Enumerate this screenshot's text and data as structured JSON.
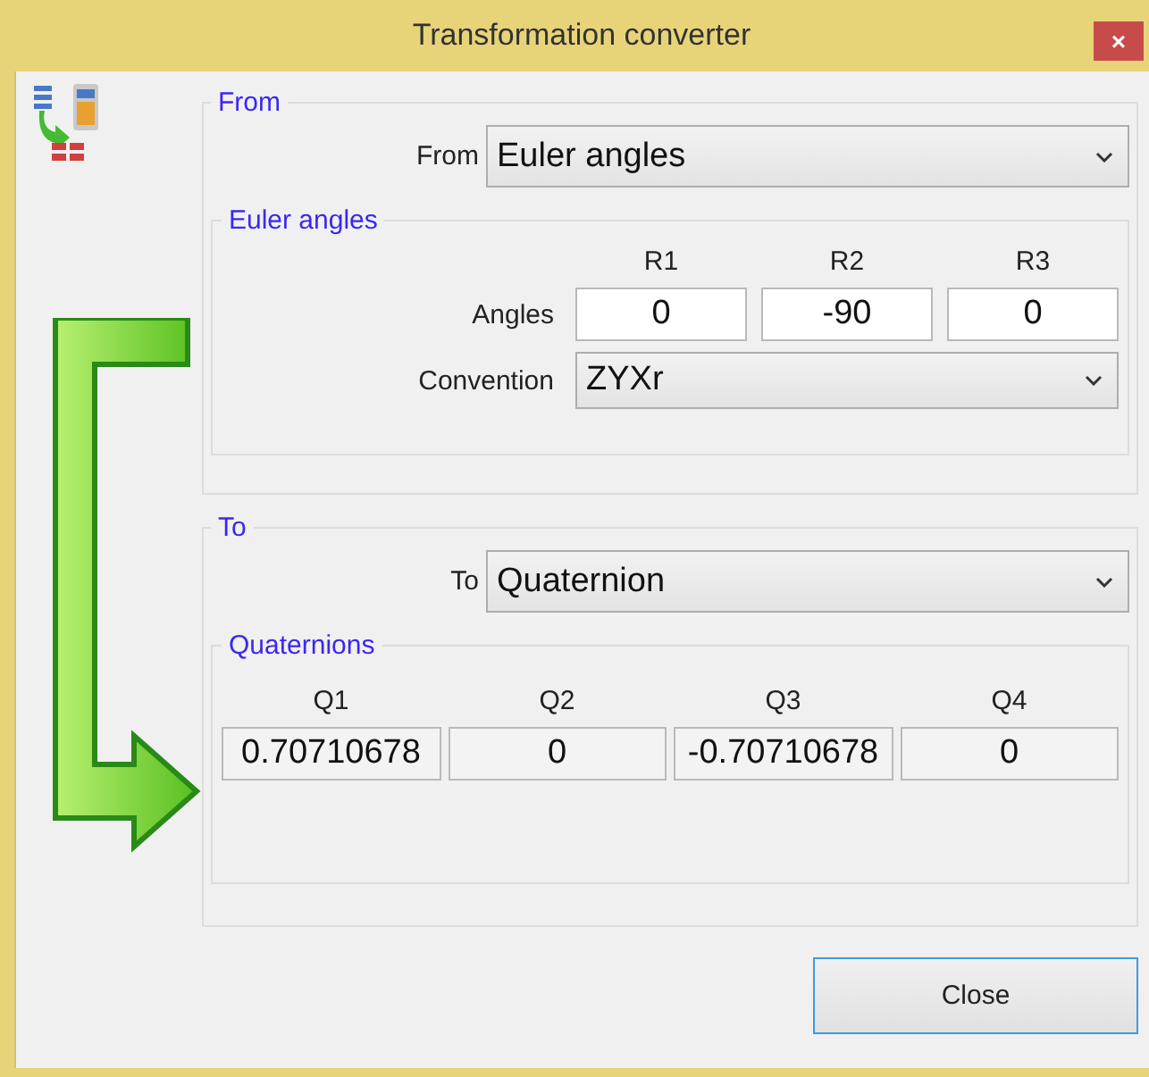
{
  "window": {
    "title": "Transformation converter",
    "close": "×"
  },
  "from": {
    "title": "From",
    "label": "From",
    "value": "Euler angles",
    "group": {
      "title": "Euler angles",
      "columns": [
        "R1",
        "R2",
        "R3"
      ],
      "row_label": "Angles",
      "values": [
        "0",
        "-90",
        "0"
      ],
      "convention_label": "Convention",
      "convention": "ZYXr"
    }
  },
  "to": {
    "title": "To",
    "label": "To",
    "value": "Quaternion",
    "group": {
      "title": "Quaternions",
      "columns": [
        "Q1",
        "Q2",
        "Q3",
        "Q4"
      ],
      "values": [
        "0.70710678",
        "0",
        "-0.70710678",
        "0"
      ]
    }
  },
  "buttons": [
    "Close"
  ]
}
